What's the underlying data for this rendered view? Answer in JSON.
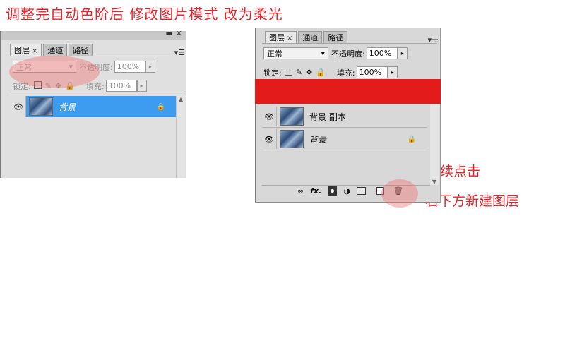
{
  "annotations": {
    "top": "调整完自动色阶后  修改图片模式 改为柔光",
    "continue_click": "继续点击",
    "new_layer": "右下方新建图层"
  },
  "left_panel": {
    "tabs": [
      "图层",
      "通道",
      "路径"
    ],
    "close_glyph": "×",
    "blend_mode": "正常",
    "opacity_label": "不透明度:",
    "opacity_value": "100%",
    "lock_label": "锁定:",
    "fill_label": "填充:",
    "fill_value": "100%",
    "layers": [
      {
        "name": "背景",
        "selected": true,
        "locked": true
      }
    ]
  },
  "right_panel": {
    "tabs": [
      "图层",
      "通道",
      "路径"
    ],
    "close_glyph": "×",
    "blend_mode": "正常",
    "opacity_label": "不透明度:",
    "opacity_value": "100%",
    "lock_label": "锁定:",
    "fill_label": "填充:",
    "fill_value": "100%",
    "layers": [
      {
        "name": "背景 副本",
        "selected": false,
        "locked": false
      },
      {
        "name": "背景",
        "selected": false,
        "locked": true
      }
    ],
    "bottom_icons": [
      "link-icon",
      "fx-icon",
      "mask-icon",
      "adjustment-icon",
      "folder-icon",
      "new-layer-icon",
      "trash-icon"
    ],
    "fx_text": "fx."
  },
  "colors": {
    "annotation_red": "#e8232a",
    "selected_layer": "#3d9bf0",
    "red_bar": "#e31b1b"
  }
}
